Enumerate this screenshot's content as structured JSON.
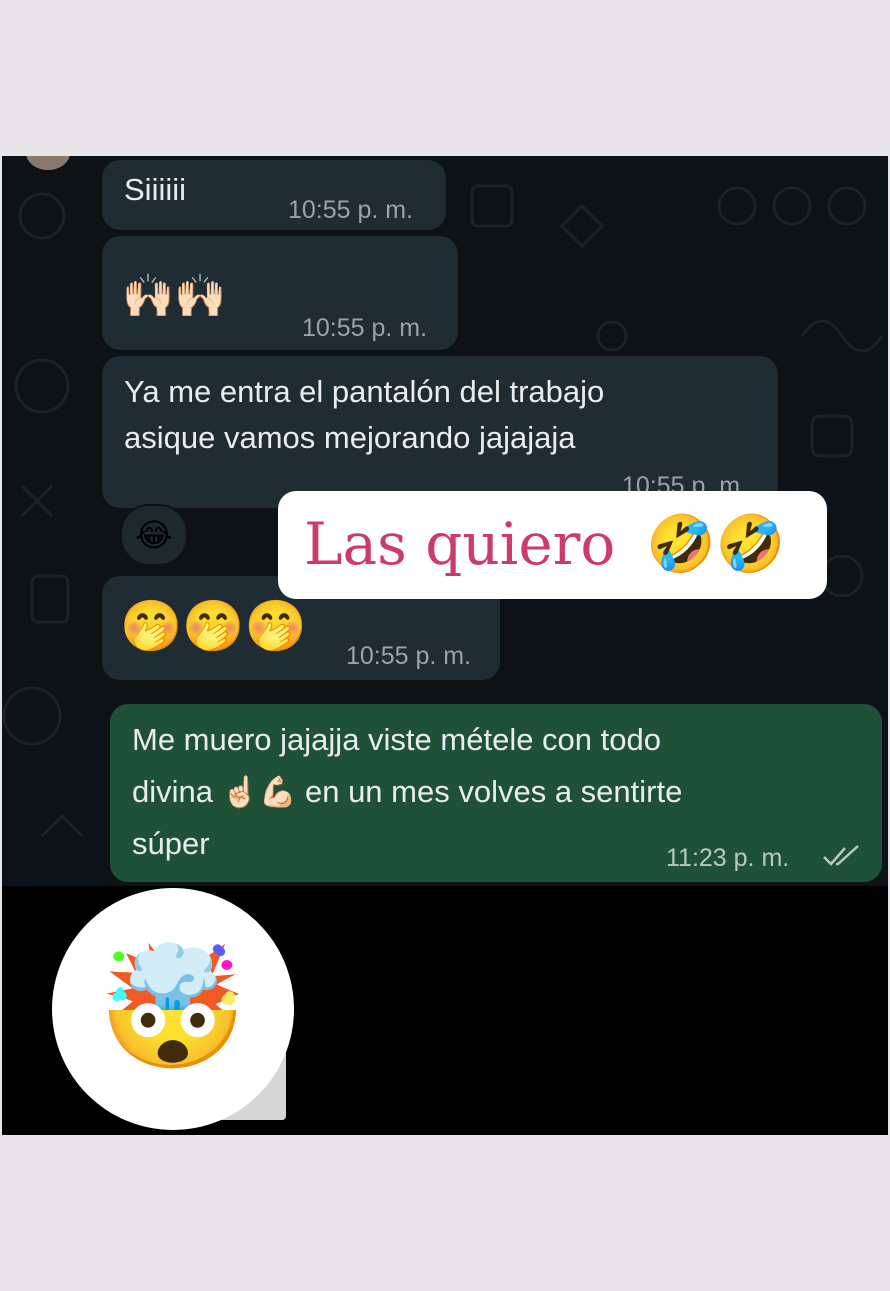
{
  "messages": [
    {
      "text": "Siiiiii",
      "time": "10:55 p. m."
    },
    {
      "emoji": "🙌🏻🙌🏻",
      "time": "10:55 p. m."
    },
    {
      "line1": "Ya me entra el pantalón del trabajo",
      "line2": "asique vamos mejorando jajajaja",
      "time": "10:55 p. m.",
      "reaction": "😂"
    },
    {
      "emoji": "🤭🤭🤭",
      "time": "10:55 p. m."
    },
    {
      "line1": "Me muero jajajja viste métele con todo",
      "line2_text": "divina",
      "line2_emoji": "☝🏻💪🏻",
      "line2_rest": "en un mes volves a sentirte",
      "line3": "súper",
      "time": "11:23 p. m.",
      "status_icon": "double-check-icon"
    }
  ],
  "caption": {
    "text": "Las quiero",
    "emoji": "🤣🤣"
  },
  "overlay_emoji": "🤯",
  "colors": {
    "chat_background": "#0c1215",
    "incoming_bubble": "#202c33",
    "outgoing_bubble": "#1f5138",
    "caption_text": "#cc3b6a"
  }
}
